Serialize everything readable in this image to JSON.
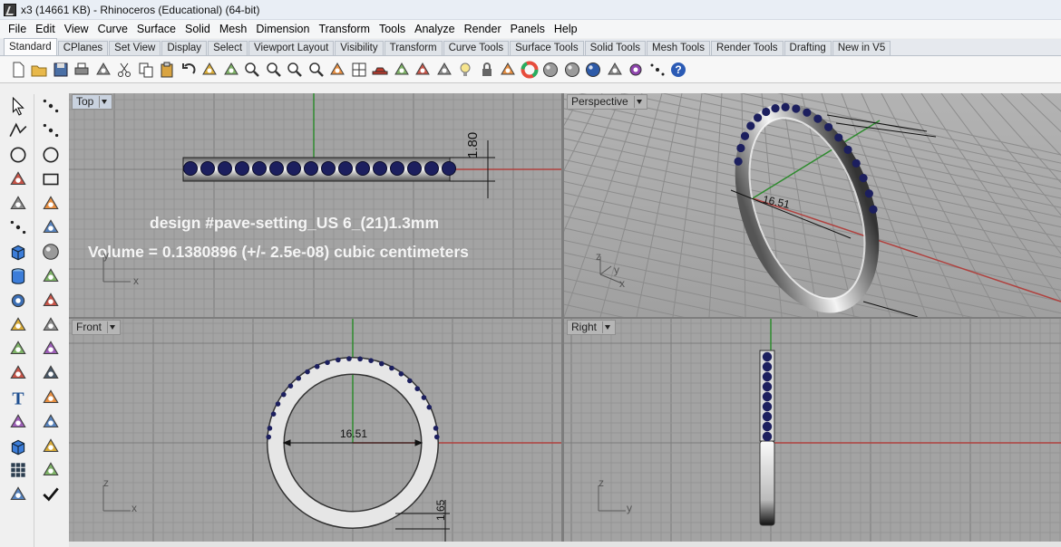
{
  "window": {
    "title": "x3 (14661 KB) - Rhinoceros (Educational) (64-bit)"
  },
  "menu": [
    "File",
    "Edit",
    "View",
    "Curve",
    "Surface",
    "Solid",
    "Mesh",
    "Dimension",
    "Transform",
    "Tools",
    "Analyze",
    "Render",
    "Panels",
    "Help"
  ],
  "tabs": [
    "Standard",
    "CPlanes",
    "Set View",
    "Display",
    "Select",
    "Viewport Layout",
    "Visibility",
    "Transform",
    "Curve Tools",
    "Surface Tools",
    "Solid Tools",
    "Mesh Tools",
    "Render Tools",
    "Drafting",
    "New in V5"
  ],
  "toolbar_icons": [
    "new-document-icon",
    "open-folder-icon",
    "save-icon",
    "print-icon",
    "import-icon",
    "cut-icon",
    "copy-icon",
    "paste-icon",
    "undo-icon",
    "pan-hand-icon",
    "move-view-icon",
    "zoom-dynamic-icon",
    "zoom-window-icon",
    "zoom-selected-icon",
    "zoom-extents-icon",
    "rotate-view-icon",
    "four-viewports-icon",
    "car-named-view-icon",
    "named-cplane-icon",
    "cplane-icon",
    "layer-icon",
    "light-bulb-icon",
    "lock-icon",
    "object-properties-icon",
    "color-wheel-icon",
    "shaded-sphere-icon",
    "rendered-sphere-icon",
    "render-sphere-icon",
    "select-filter-icon",
    "options-gear-icon",
    "snap-points-icon",
    "help-icon"
  ],
  "left_tools": {
    "col1": [
      "select-arrow-icon",
      "polyline-icon",
      "circle-icon",
      "arc-icon",
      "polygon-icon",
      "curve-point-icon",
      "box-solid-icon",
      "cylinder-icon",
      "boolean-gear-icon",
      "extrude-icon",
      "solid-union-icon",
      "fillet-curve-icon",
      "text-icon",
      "group-icon",
      "cube-solid-icon",
      "grid-array-icon",
      "smash-icon"
    ],
    "col2": [
      "point-icon",
      "control-points-icon",
      "ellipse-icon",
      "rectangle-icon",
      "rounded-curve-icon",
      "surface-loft-icon",
      "sphere-icon",
      "planar-surface-icon",
      "extrude-arrow-icon",
      "split-icon",
      "explode-icon",
      "blend-icon",
      "move-icon",
      "mirror-icon",
      "dimension-icon",
      "rotate-icon",
      "check-mark-icon"
    ]
  },
  "viewports": {
    "top": {
      "label": "Top",
      "design_text": "design #pave-setting_US 6_(21)1.3mm",
      "volume_text": "Volume = 0.1380896 (+/- 2.5e-08) cubic centimeters",
      "dimension": "1.80",
      "axis_x": "x",
      "axis_y": "y"
    },
    "perspective": {
      "label": "Perspective",
      "dimension": "16.51",
      "axis_x": "x",
      "axis_y": "y",
      "axis_z": "z"
    },
    "front": {
      "label": "Front",
      "dimension": "16.51",
      "thickness": "1.65",
      "axis_x": "x",
      "axis_z": "z"
    },
    "right": {
      "label": "Right",
      "axis_y": "y",
      "axis_z": "z"
    }
  },
  "colors": {
    "viewport_bg": "#a3a3a3",
    "grid_minor": "#949494",
    "grid_major": "#7d7d7d",
    "x_axis": "#b0413e",
    "y_axis": "#2e8b2e",
    "gem": "#1c1f5e",
    "metal": "#e6e6e6",
    "overlay_text": "#f4f4f4"
  }
}
